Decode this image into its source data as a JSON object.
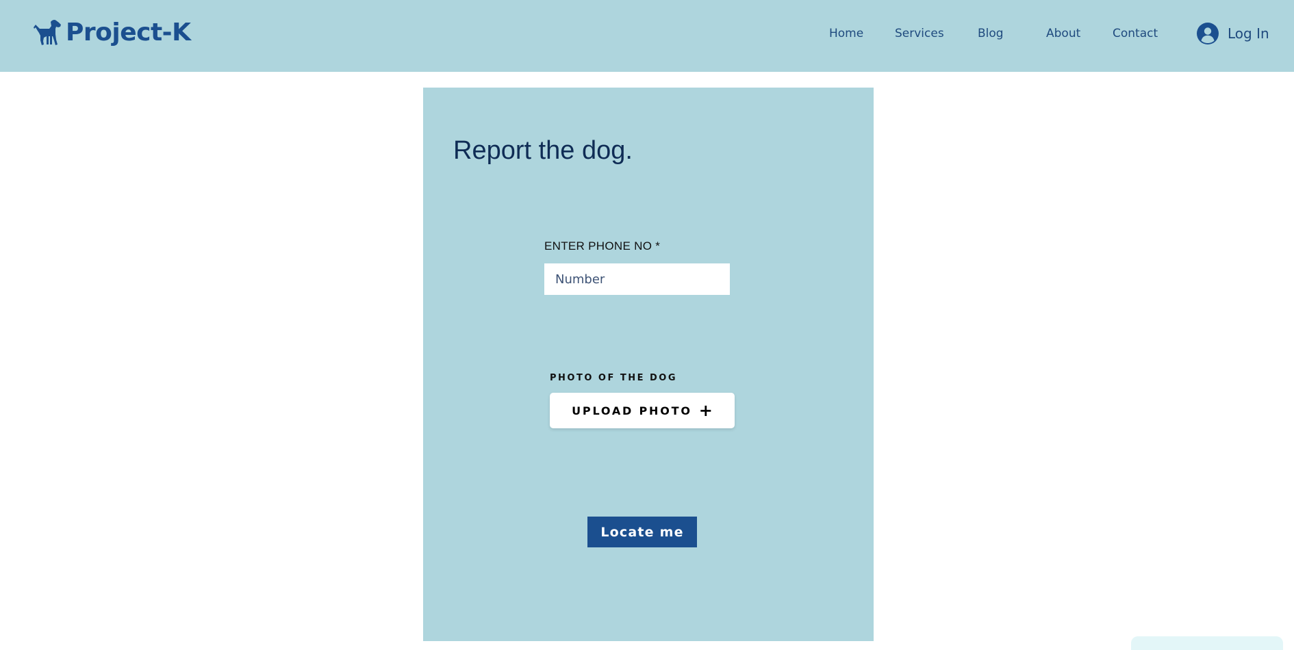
{
  "site": {
    "logo_text": "Project-K",
    "logo_icon": "dog-icon",
    "brand_color": "#1b4f8f",
    "header_background": "#aed5dd"
  },
  "nav": {
    "home": "Home",
    "services": "Services",
    "blog": "Blog",
    "about": "About",
    "contact": "Contact"
  },
  "login": {
    "label": "Log In",
    "icon": "user-avatar-icon"
  },
  "form": {
    "title": "Report the dog.",
    "background": "#aed5dd",
    "phone": {
      "label": "ENTER PHONE NO *",
      "placeholder": "Number",
      "value": ""
    },
    "photo": {
      "label": "PHOTO OF THE DOG",
      "upload_label": "UPLOAD PHOTO",
      "upload_icon": "plus-icon"
    },
    "locate_button": "Locate me"
  }
}
